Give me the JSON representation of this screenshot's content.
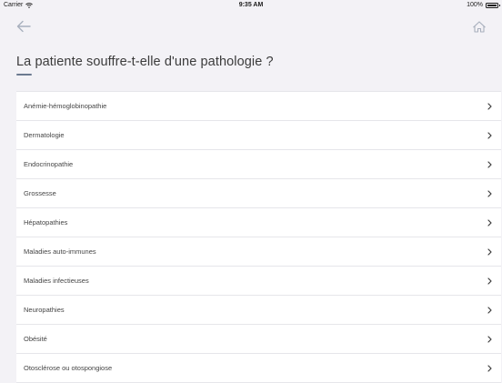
{
  "status_bar": {
    "carrier": "Carrier",
    "time": "9:35 AM",
    "battery": "100%",
    "battery_level": 1.0
  },
  "nav": {
    "back_icon": "arrow-left-icon",
    "home_icon": "home-icon"
  },
  "page": {
    "title": "La patiente souffre-t-elle d'une pathologie ?"
  },
  "pathologies": [
    {
      "label": "Anémie-hémoglobinopathie"
    },
    {
      "label": "Dermatologie"
    },
    {
      "label": "Endocrinopathie"
    },
    {
      "label": "Grossesse"
    },
    {
      "label": "Hépatopathies"
    },
    {
      "label": "Maladies auto-immunes"
    },
    {
      "label": "Maladies infectieuses"
    },
    {
      "label": "Neuropathies"
    },
    {
      "label": "Obésité"
    },
    {
      "label": "Otosclérose ou otospongiose"
    }
  ],
  "colors": {
    "background": "#f3f2f6",
    "accent": "#6b7a90",
    "icon": "#a8b0bd"
  }
}
